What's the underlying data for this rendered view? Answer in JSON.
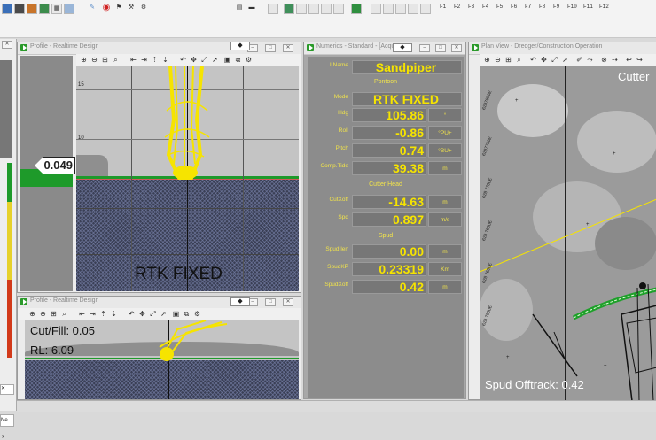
{
  "toolbar": {
    "fkeys": [
      "F1",
      "F2",
      "F3",
      "F4",
      "F5",
      "F6",
      "F7",
      "F8",
      "F9",
      "F10",
      "F11",
      "F12"
    ]
  },
  "profile_top": {
    "title": "Profile - Realtime Design",
    "depth_readout": "0.049",
    "axis_ticks": [
      "15",
      "10"
    ],
    "status_text": "RTK FIXED"
  },
  "profile_bottom": {
    "title": "Profile - Realtime Design",
    "cutfill": "Cut/Fill: 0.05",
    "rl": "RL: 6.09"
  },
  "left_panel": {
    "tab_text": "Ne"
  },
  "numerics": {
    "title": "Numerics - Standard - [Acqu",
    "lname_label": "LName",
    "lname_value": "Sandpiper",
    "pontoon_header": "Pontoon",
    "mode_label": "Mode",
    "mode_value": "RTK FIXED",
    "rows_pontoon": [
      {
        "label": "Hdg",
        "value": "105.86",
        "unit": "°"
      },
      {
        "label": "Roll",
        "value": "-0.86",
        "unit": "°PU+"
      },
      {
        "label": "Pitch",
        "value": "0.74",
        "unit": "°BU+"
      },
      {
        "label": "Comp.Tide",
        "value": "39.38",
        "unit": "m"
      }
    ],
    "cutter_header": "Cutter Head",
    "rows_cutter": [
      {
        "label": "CutXoff",
        "value": "-14.63",
        "unit": "m"
      },
      {
        "label": "Spd",
        "value": "0.897",
        "unit": "m/s"
      }
    ],
    "spud_header": "Spud",
    "rows_spud": [
      {
        "label": "Spud len",
        "value": "0.00",
        "unit": "m"
      },
      {
        "label": "SpudKP",
        "value": "0.23319",
        "unit": "Km"
      },
      {
        "label": "SpudXoff",
        "value": "0.42",
        "unit": "m"
      }
    ]
  },
  "planview": {
    "title": "Plan View - Dredger/Construction Operation",
    "cutter_label": "Cutter",
    "spud_offtrack": "Spud Offtrack: 0.42",
    "grid_labels": [
      "6287800E",
      "6287750E",
      "628 7700E",
      "628 7650E",
      "628 7600E",
      "628 7550E"
    ]
  },
  "colors": {
    "yellow_value": "#f6e400",
    "numerics_bg": "#8c8c8c",
    "seabed_green": "#1e9a2a"
  }
}
